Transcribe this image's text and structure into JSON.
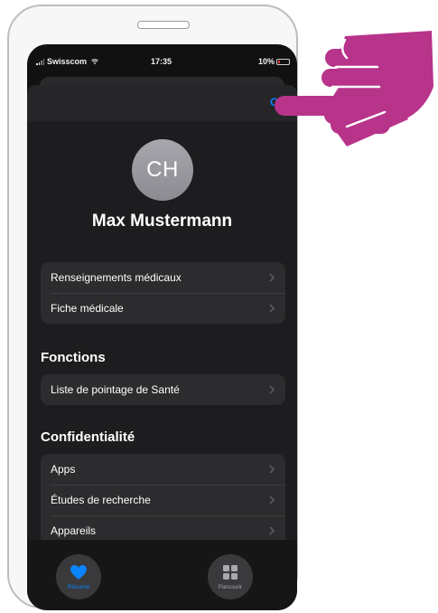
{
  "status_bar": {
    "carrier": "Swisscom",
    "time": "17:35",
    "battery": "10%"
  },
  "sheet": {
    "done_button": "OK"
  },
  "profile": {
    "initials": "CH",
    "name": "Max Mustermann"
  },
  "groups": {
    "medical": [
      "Renseignements médicaux",
      "Fiche médicale"
    ],
    "functions_title": "Fonctions",
    "functions": [
      "Liste de pointage de Santé"
    ],
    "privacy_title": "Confidentialité",
    "privacy": [
      "Apps",
      "Études de recherche",
      "Appareils"
    ]
  },
  "tabbar": {
    "summary_label": "Résumé",
    "browse_label": "Parcourir"
  },
  "colors": {
    "accent": "#0a84ff",
    "hand": "#b8338a",
    "screen_bg": "#111112"
  },
  "icons": [
    "signal-bars-icon",
    "wifi-icon",
    "battery-icon",
    "chevron-right-icon",
    "heart-icon",
    "grid-icon",
    "pointing-hand-icon"
  ]
}
